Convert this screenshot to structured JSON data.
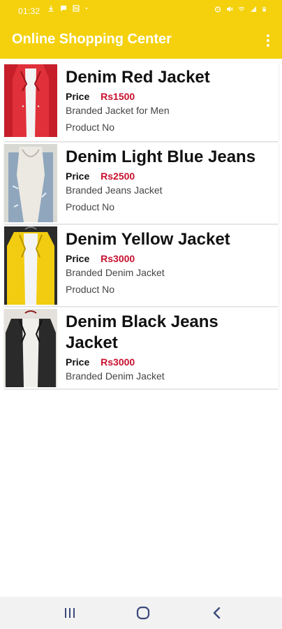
{
  "status": {
    "time": "01:32",
    "left_icons": [
      "download-icon",
      "message-icon",
      "nfc-icon",
      "dot-icon"
    ],
    "right_icons": [
      "alarm-icon",
      "mute-icon",
      "wifi-icon",
      "signal-icon",
      "battery-icon"
    ]
  },
  "app": {
    "title": "Online Shopping Center",
    "menu_icon": "overflow-menu-icon",
    "accent": "#f4d10c",
    "price_color": "#c8102e"
  },
  "products": [
    {
      "name": "Denim Red Jacket",
      "price_label": "Price",
      "price": "Rs1500",
      "description": "Branded Jacket for Men",
      "product_no": "Product No",
      "color": "#d9232d"
    },
    {
      "name": "Denim Light Blue Jeans",
      "price_label": "Price",
      "price": "Rs2500",
      "description": "Branded Jeans Jacket",
      "product_no": "Product No",
      "color": "#8fa6bd"
    },
    {
      "name": "Denim Yellow Jacket",
      "price_label": "Price",
      "price": "Rs3000",
      "description": "Branded Denim Jacket",
      "product_no": "Product No",
      "color": "#f1cc10"
    },
    {
      "name": "Denim Black Jeans Jacket",
      "price_label": "Price",
      "price": "Rs3000",
      "description": "Branded Denim Jacket",
      "color": "#2a2a2a"
    }
  ],
  "navbar": {
    "icons": [
      "recent-apps-icon",
      "home-icon",
      "back-icon"
    ]
  }
}
